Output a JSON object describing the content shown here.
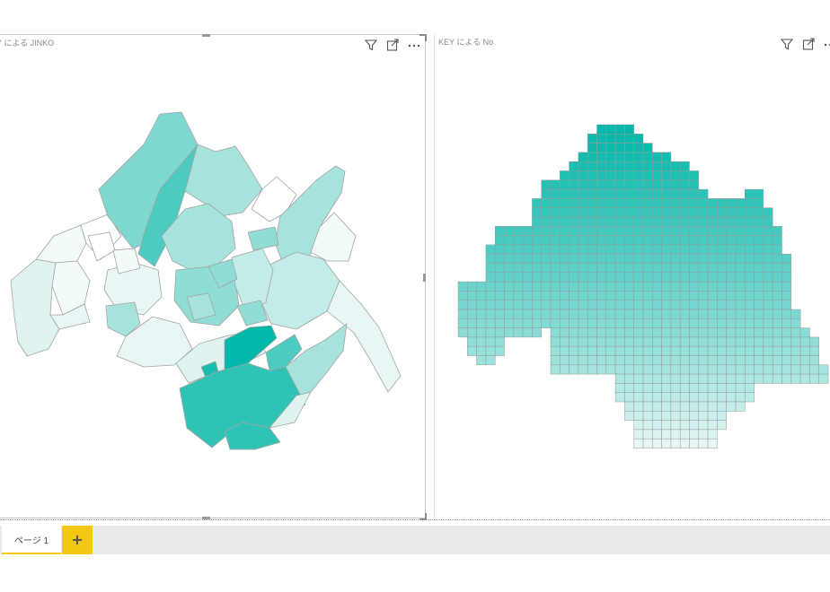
{
  "visuals": [
    {
      "id": "left",
      "title": "Y による JINKO",
      "header_icons": [
        "filter-icon",
        "focus-mode-icon",
        "more-options-icon"
      ],
      "color_scale": {
        "min": "#e8f7f5",
        "max": "#01b8aa"
      }
    },
    {
      "id": "right",
      "title": "KEY による No",
      "header_icons": [
        "filter-icon",
        "focus-mode-icon",
        "more-options-icon"
      ],
      "color_scale": {
        "min": "#e8f7f5",
        "max": "#01b8aa"
      }
    }
  ],
  "page_tabs": [
    {
      "label": "ページ 1",
      "active": true
    }
  ],
  "add_page_icon": "plus-icon",
  "colors": {
    "accent": "#f2c811",
    "map_stroke": "#a0a0a0",
    "tab_bar": "#eaeaea"
  }
}
